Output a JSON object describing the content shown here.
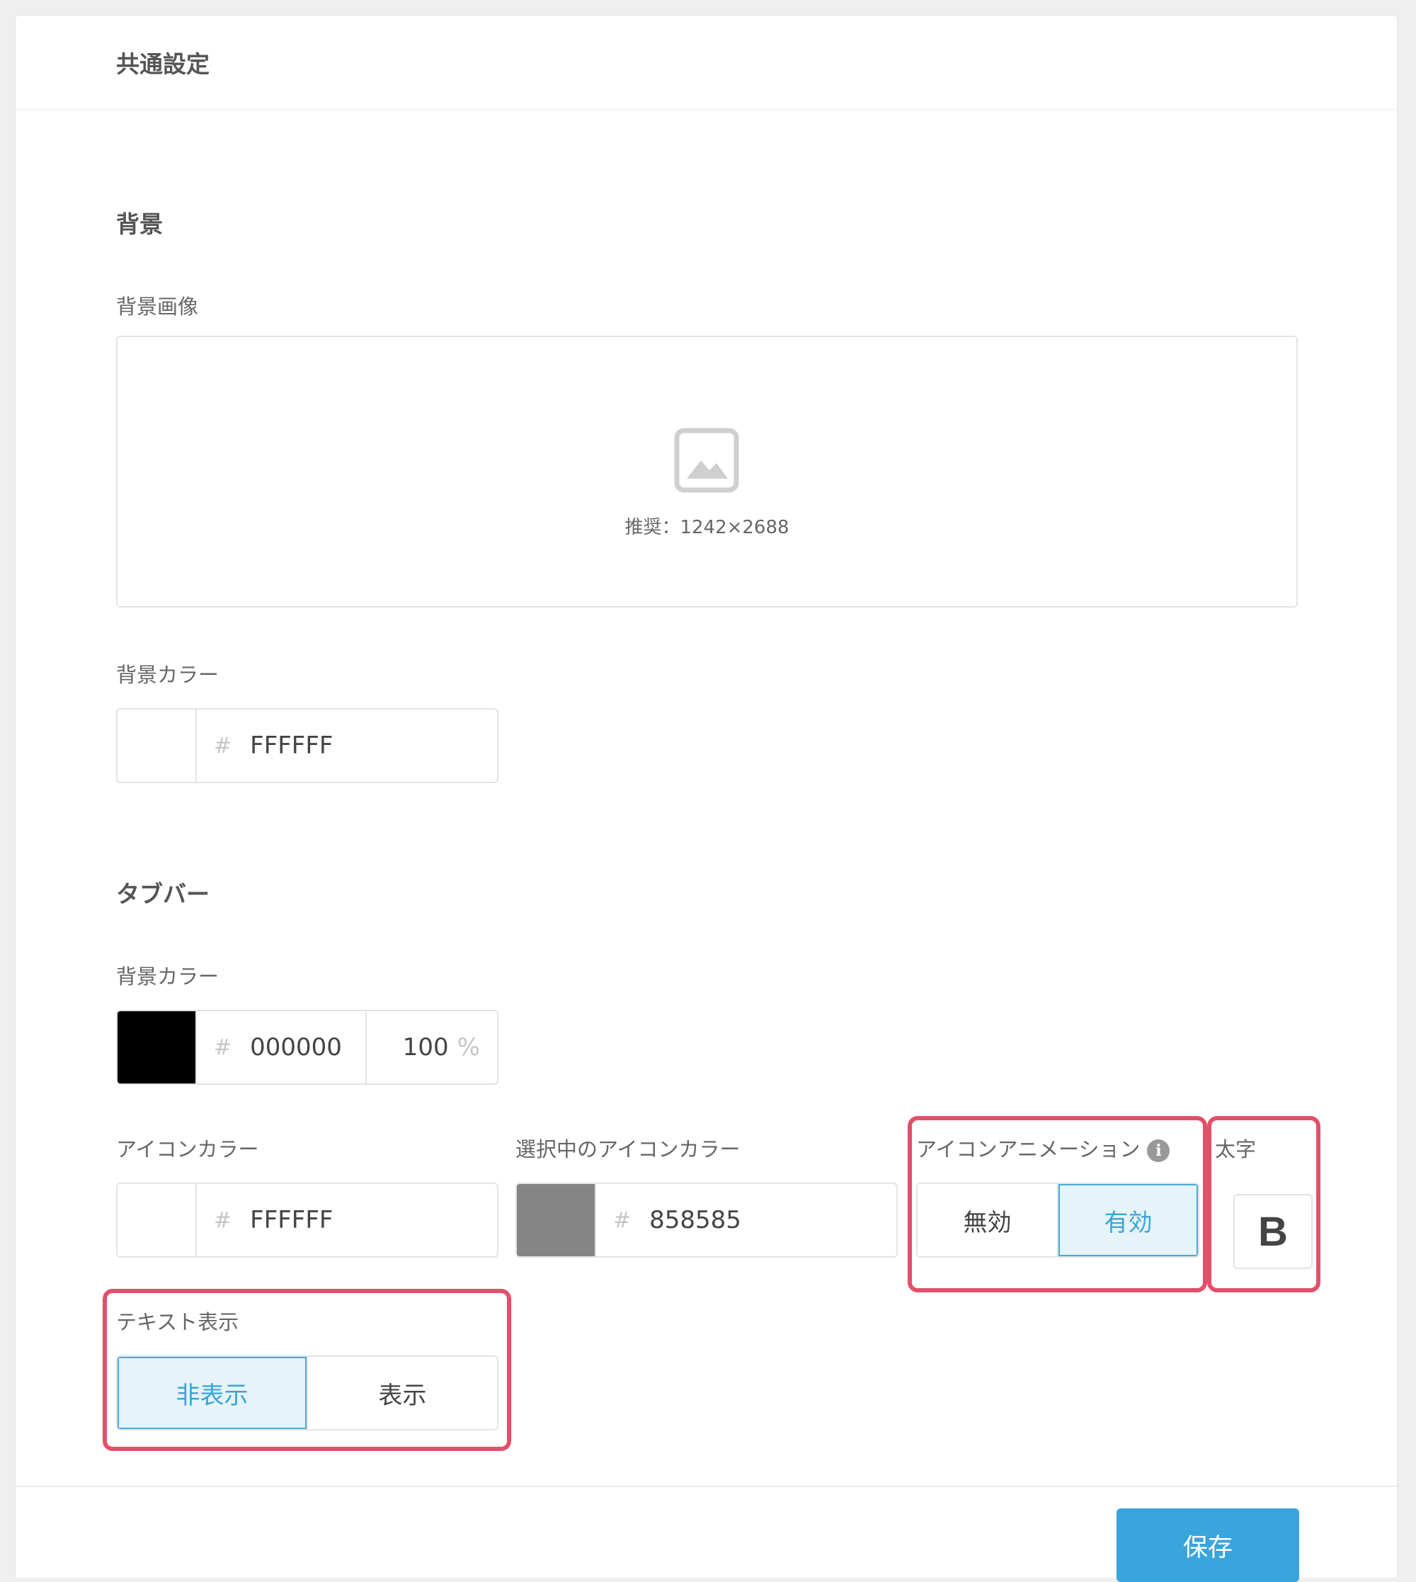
{
  "header": {
    "title": "共通設定"
  },
  "background": {
    "section_title": "背景",
    "image_label": "背景画像",
    "image_hint": "推奨：1242×2688",
    "color_label": "背景カラー",
    "color_value": "FFFFFF",
    "color_swatch": "#FFFFFF"
  },
  "tabbar": {
    "section_title": "タブバー",
    "bg_color_label": "背景カラー",
    "bg_color_value": "000000",
    "bg_color_swatch": "#000000",
    "bg_opacity": "100",
    "opacity_unit": "%",
    "icon_color_label": "アイコンカラー",
    "icon_color_value": "FFFFFF",
    "icon_color_swatch": "#FFFFFF",
    "selected_icon_color_label": "選択中のアイコンカラー",
    "selected_icon_color_value": "858585",
    "selected_icon_color_swatch": "#858585",
    "icon_animation_label": "アイコンアニメーション",
    "icon_animation_options": [
      "無効",
      "有効"
    ],
    "icon_animation_selected": "有効",
    "bold_label": "太字",
    "bold_button": "B",
    "text_display_label": "テキスト表示",
    "text_display_options": [
      "非表示",
      "表示"
    ],
    "text_display_selected": "非表示"
  },
  "footer": {
    "save_label": "保存"
  },
  "colors": {
    "accent": "#3aa5dc",
    "highlight": "#e2506a"
  }
}
